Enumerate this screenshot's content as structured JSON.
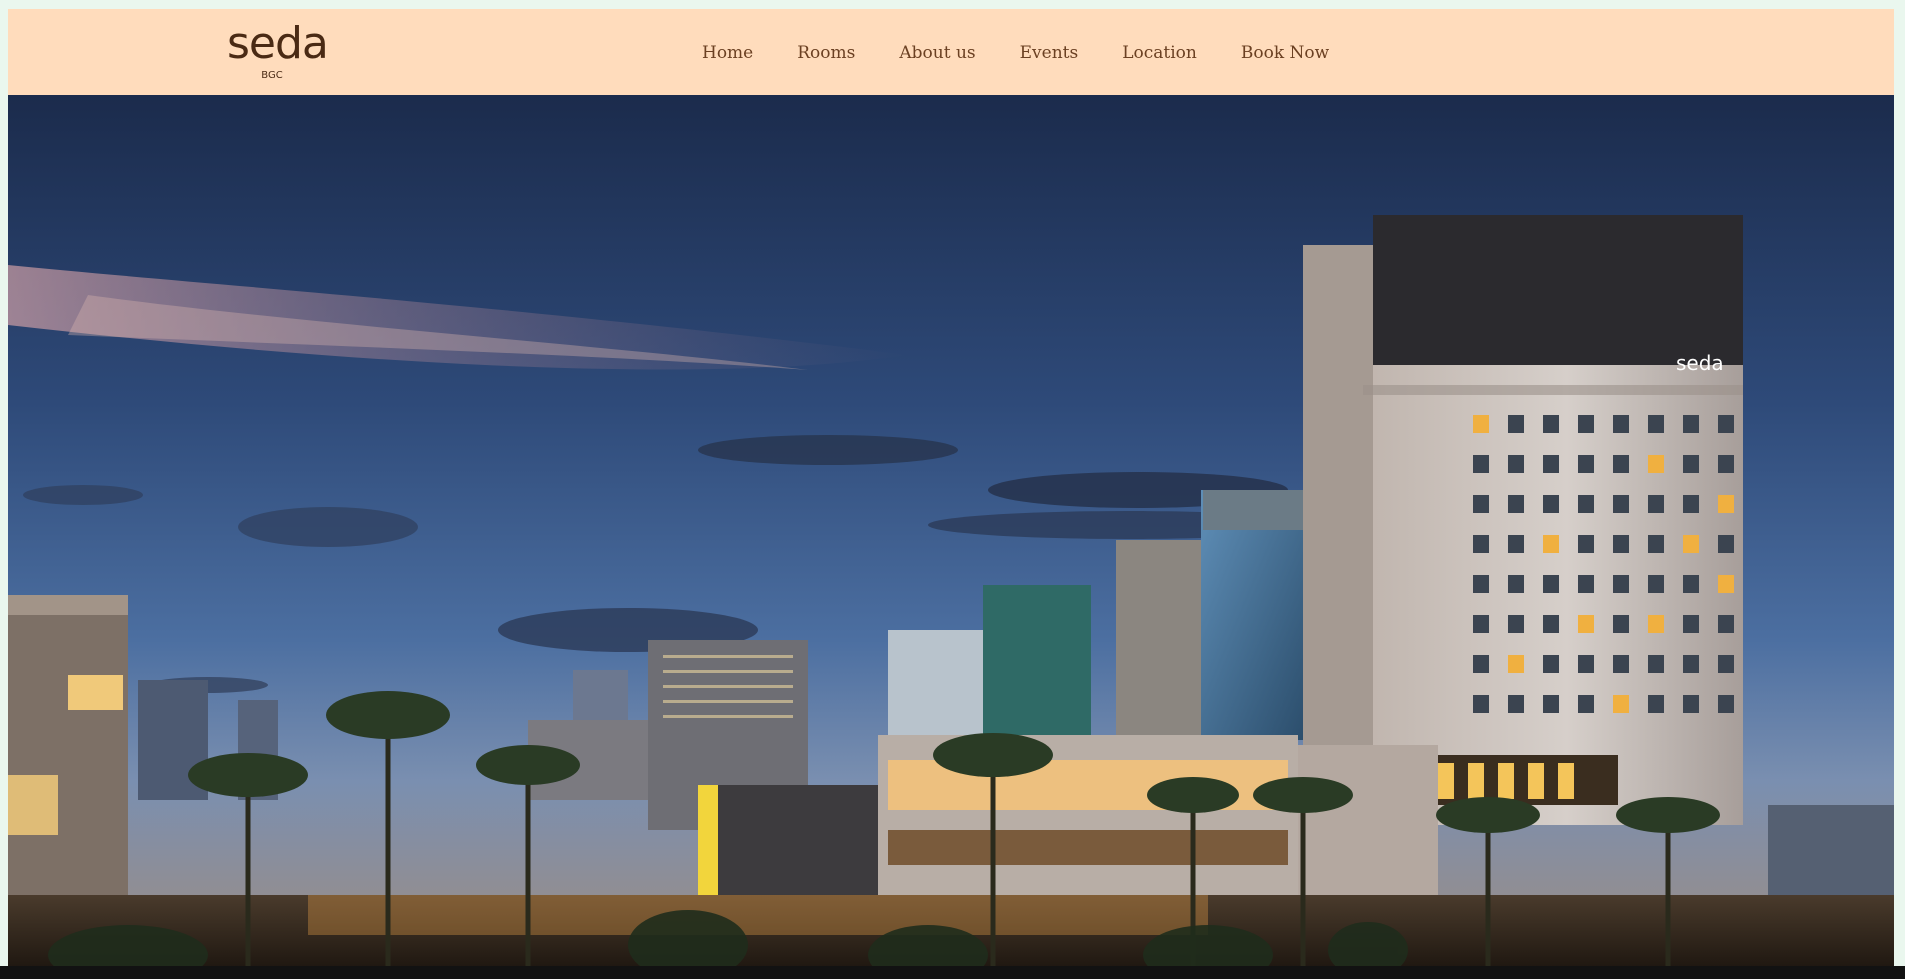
{
  "logo": {
    "wordmark": "seda",
    "sub": "BGC"
  },
  "nav": {
    "items": [
      {
        "label": "Home",
        "name": "nav-home"
      },
      {
        "label": "Rooms",
        "name": "nav-rooms"
      },
      {
        "label": "About us",
        "name": "nav-about"
      },
      {
        "label": "Events",
        "name": "nav-events"
      },
      {
        "label": "Location",
        "name": "nav-location"
      },
      {
        "label": "Book Now",
        "name": "nav-book-now"
      }
    ]
  },
  "hero": {
    "building_sign": "seda"
  },
  "colors": {
    "navbar_bg": "#ffdcbc",
    "nav_text": "#6b4022",
    "logo_text": "#4a2a14",
    "page_bg": "#eaf7ee"
  }
}
